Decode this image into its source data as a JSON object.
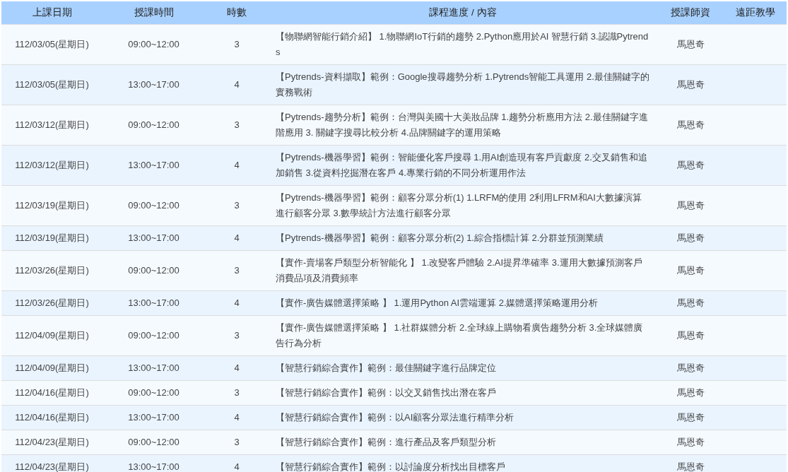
{
  "table": {
    "columns": [
      "上課日期",
      "授課時間",
      "時數",
      "課程進度 / 內容",
      "授課師資",
      "遠距教學"
    ],
    "rows": [
      {
        "date": "112/03/05(星期日)",
        "time": "09:00~12:00",
        "hours": "3",
        "content": "【物聯網智能行銷介紹】 1.物聯網IoT行銷的趨勢 2.Python應用於AI 智慧行銷 3.認識Pytrends",
        "teacher": "馬恩奇"
      },
      {
        "date": "112/03/05(星期日)",
        "time": "13:00~17:00",
        "hours": "4",
        "content": "【Pytrends-資料擷取】範例：Google搜尋趨勢分析 1.Pytrends智能工具運用 2.最佳關鍵字的實務戰術",
        "teacher": "馬恩奇"
      },
      {
        "date": "112/03/12(星期日)",
        "time": "09:00~12:00",
        "hours": "3",
        "content": "【Pytrends-趨勢分析】範例：台灣與美國十大美妝品牌 1.趨勢分析應用方法 2.最佳關鍵字進階應用 3. 關鍵字搜尋比較分析 4.品牌關鍵字的運用策略",
        "teacher": "馬恩奇"
      },
      {
        "date": "112/03/12(星期日)",
        "time": "13:00~17:00",
        "hours": "4",
        "content": "【Pytrends-機器學習】範例：智能優化客戶搜尋 1.用AI創造現有客戶貢獻度 2.交叉銷售和追加銷售 3.從資料挖掘潛在客戶 4.專業行銷的不同分析運用作法",
        "teacher": "馬恩奇"
      },
      {
        "date": "112/03/19(星期日)",
        "time": "09:00~12:00",
        "hours": "3",
        "content": "【Pytrends-機器學習】範例：顧客分眾分析(1) 1.LRFM的使用 2利用LFRM和AI大數據演算進行顧客分眾 3.數學統計方法進行顧客分眾",
        "teacher": "馬恩奇"
      },
      {
        "date": "112/03/19(星期日)",
        "time": "13:00~17:00",
        "hours": "4",
        "content": "【Pytrends-機器學習】範例：顧客分眾分析(2) 1.綜合指標計算 2.分群並預測業績",
        "teacher": "馬恩奇"
      },
      {
        "date": "112/03/26(星期日)",
        "time": "09:00~12:00",
        "hours": "3",
        "content": "【實作-賣場客戶類型分析智能化 】 1.改變客戶體驗 2.AI提昇準確率 3.運用大數據預測客戶消費品項及消費頻率",
        "teacher": "馬恩奇"
      },
      {
        "date": "112/03/26(星期日)",
        "time": "13:00~17:00",
        "hours": "4",
        "content": "【實作-廣告媒體選擇策略 】 1.運用Python AI雲端運算 2.媒體選擇策略運用分析",
        "teacher": "馬恩奇"
      },
      {
        "date": "112/04/09(星期日)",
        "time": "09:00~12:00",
        "hours": "3",
        "content": "【實作-廣告媒體選擇策略 】 1.社群媒體分析 2.全球線上購物看廣告趨勢分析 3.全球媒體廣告行為分析",
        "teacher": "馬恩奇"
      },
      {
        "date": "112/04/09(星期日)",
        "time": "13:00~17:00",
        "hours": "4",
        "content": "【智慧行銷綜合實作】範例：最佳關鍵字進行品牌定位",
        "teacher": "馬恩奇"
      },
      {
        "date": "112/04/16(星期日)",
        "time": "09:00~12:00",
        "hours": "3",
        "content": "【智慧行銷綜合實作】範例：以交叉銷售找出潛在客戶",
        "teacher": "馬恩奇"
      },
      {
        "date": "112/04/16(星期日)",
        "time": "13:00~17:00",
        "hours": "4",
        "content": "【智慧行銷綜合實作】範例：以AI顧客分眾法進行精準分析",
        "teacher": "馬恩奇"
      },
      {
        "date": "112/04/23(星期日)",
        "time": "09:00~12:00",
        "hours": "3",
        "content": "【智慧行銷綜合實作】範例：進行產品及客戶類型分析",
        "teacher": "馬恩奇"
      },
      {
        "date": "112/04/23(星期日)",
        "time": "13:00~17:00",
        "hours": "4",
        "content": "【智慧行銷綜合實作】範例：以討論度分析找出目標客戶",
        "teacher": "馬恩奇"
      }
    ]
  }
}
